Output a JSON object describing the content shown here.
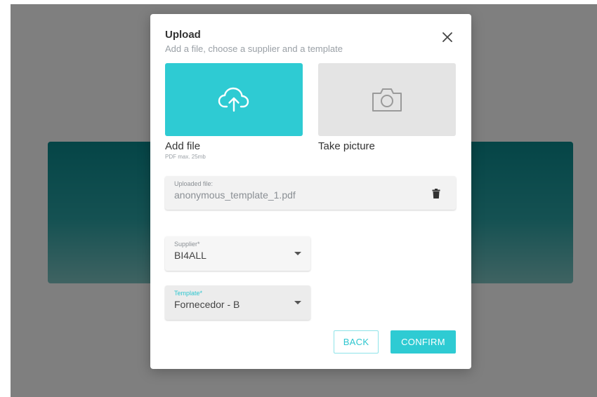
{
  "dialog": {
    "title": "Upload",
    "subtitle": "Add a file, choose a supplier and a template",
    "close_icon": "close-icon"
  },
  "sources": {
    "add_file": {
      "label": "Add file",
      "hint": "PDF max. 25mb",
      "icon": "cloud-upload-icon",
      "color": "#2ecbd3"
    },
    "take_picture": {
      "label": "Take picture",
      "icon": "camera-icon",
      "color": "#e4e4e4"
    }
  },
  "uploaded_file": {
    "label": "Uploaded file:",
    "value": "anonymous_template_1.pdf",
    "icon": "trash-icon"
  },
  "supplier": {
    "label": "Supplier*",
    "value": "BI4ALL"
  },
  "template": {
    "label": "Template*",
    "value": "Fornecedor - B"
  },
  "actions": {
    "back_label": "BACK",
    "confirm_label": "CONFIRM"
  },
  "colors": {
    "accent": "#2ecbd3",
    "overlay": "rgba(0,0,0,0.5)"
  }
}
